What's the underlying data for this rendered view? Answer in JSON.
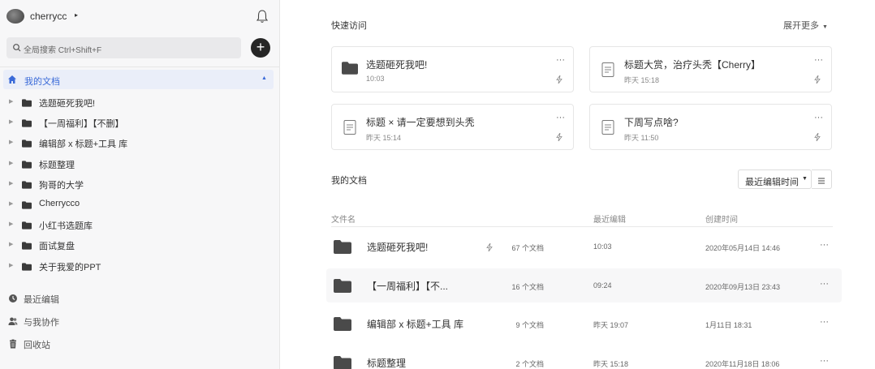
{
  "user": {
    "name": "cherrycc",
    "caret": "▸"
  },
  "search": {
    "placeholder": "全局搜索 Ctrl+Shift+F"
  },
  "add_label": "+",
  "sidebar": {
    "root_label": "我的文档",
    "root_caret": "▲",
    "tree": [
      "选题砸死我吧!",
      "【一周福利】【不删】",
      "编辑部 x 标题+工具 库",
      "标题整理",
      "狗哥的大学",
      "Cherrycco",
      "小红书选题库",
      "面试复盘",
      "关于我爱的PPT"
    ],
    "bottom": [
      {
        "label": "最近编辑",
        "icon": "clock-icon"
      },
      {
        "label": "与我协作",
        "icon": "users-icon"
      },
      {
        "label": "回收站",
        "icon": "trash-icon"
      }
    ]
  },
  "quick_access": {
    "title": "快速访问",
    "expand_label": "展开更多",
    "cards": [
      {
        "title": "选题砸死我吧!",
        "time": "10:03",
        "icon": "folder-icon"
      },
      {
        "title": "标题大赏，治疗头秃【Cherry】",
        "time": "昨天 15:18",
        "icon": "doc-icon"
      },
      {
        "title": "标题 × 请一定要想到头秃",
        "time": "昨天 15:14",
        "icon": "doc-icon"
      },
      {
        "title": "下周写点啥?",
        "time": "昨天 11:50",
        "icon": "doc-icon"
      }
    ],
    "more": "···"
  },
  "my_docs": {
    "title": "我的文档",
    "sort_label": "最近编辑时间",
    "columns": {
      "name": "文件名",
      "edited": "最近编辑",
      "created": "创建时间"
    },
    "rows": [
      {
        "name": "选题砸死我吧!",
        "count": "67 个文档",
        "edited": "10:03",
        "created": "2020年05月14日 14:46",
        "starred": true
      },
      {
        "name": "【一周福利】【不...",
        "count": "16 个文档",
        "edited": "09:24",
        "created": "2020年09月13日 23:43",
        "starred": false
      },
      {
        "name": "编辑部 x 标题+工具 库",
        "count": "9 个文档",
        "edited": "昨天 19:07",
        "created": "1月11日 18:31",
        "starred": false
      },
      {
        "name": "标题整理",
        "count": "2 个文档",
        "edited": "昨天 15:18",
        "created": "2020年11月18日 18:06",
        "starred": false
      }
    ],
    "more": "···"
  },
  "colors": {
    "accent": "#3a6ad8",
    "folder": "#4a4a4a",
    "sidebar_bg": "#f7f7f8",
    "selected_bg": "#eaeef9"
  }
}
